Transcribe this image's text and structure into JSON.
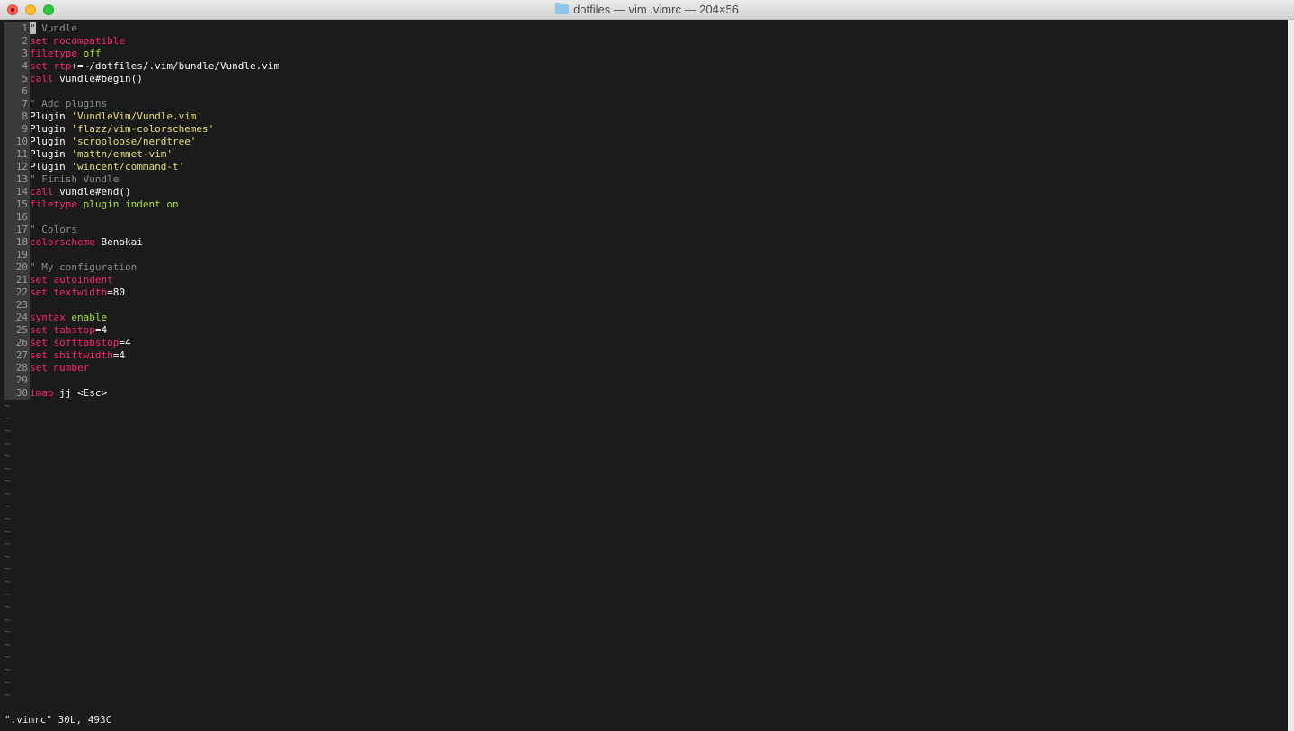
{
  "window": {
    "title": "dotfiles — vim .vimrc — 204×56"
  },
  "editor": {
    "lines": [
      {
        "n": "1",
        "tokens": [
          {
            "t": "\"",
            "c": "cursor"
          },
          {
            "t": " Vundle",
            "c": "com"
          }
        ]
      },
      {
        "n": "2",
        "tokens": [
          {
            "t": "set nocompatible",
            "c": "kw"
          }
        ]
      },
      {
        "n": "3",
        "tokens": [
          {
            "t": "filetype",
            "c": "kw"
          },
          {
            "t": " ",
            "c": "txt"
          },
          {
            "t": "off",
            "c": "grn"
          }
        ]
      },
      {
        "n": "4",
        "tokens": [
          {
            "t": "set",
            "c": "kw"
          },
          {
            "t": " ",
            "c": "txt"
          },
          {
            "t": "rtp",
            "c": "kw"
          },
          {
            "t": "+=~/dotfiles/.vim/bundle/Vundle.vim",
            "c": "txt"
          }
        ]
      },
      {
        "n": "5",
        "tokens": [
          {
            "t": "call",
            "c": "kw"
          },
          {
            "t": " vundle#begin()",
            "c": "txt"
          }
        ]
      },
      {
        "n": "6",
        "tokens": []
      },
      {
        "n": "7",
        "tokens": [
          {
            "t": "\" Add plugins",
            "c": "com"
          }
        ]
      },
      {
        "n": "8",
        "tokens": [
          {
            "t": "Plugin ",
            "c": "txt"
          },
          {
            "t": "'VundleVim/Vundle.vim'",
            "c": "str"
          }
        ]
      },
      {
        "n": "9",
        "tokens": [
          {
            "t": "Plugin ",
            "c": "txt"
          },
          {
            "t": "'flazz/vim-colorschemes'",
            "c": "str"
          }
        ]
      },
      {
        "n": "10",
        "tokens": [
          {
            "t": "Plugin ",
            "c": "txt"
          },
          {
            "t": "'scrooloose/nerdtree'",
            "c": "str"
          }
        ]
      },
      {
        "n": "11",
        "tokens": [
          {
            "t": "Plugin ",
            "c": "txt"
          },
          {
            "t": "'mattn/emmet-vim'",
            "c": "str"
          }
        ]
      },
      {
        "n": "12",
        "tokens": [
          {
            "t": "Plugin ",
            "c": "txt"
          },
          {
            "t": "'wincent/command-t'",
            "c": "str"
          }
        ]
      },
      {
        "n": "13",
        "tokens": [
          {
            "t": "\" Finish Vundle",
            "c": "com"
          }
        ]
      },
      {
        "n": "14",
        "tokens": [
          {
            "t": "call",
            "c": "kw"
          },
          {
            "t": " vundle#end()",
            "c": "txt"
          }
        ]
      },
      {
        "n": "15",
        "tokens": [
          {
            "t": "filetype",
            "c": "kw"
          },
          {
            "t": " ",
            "c": "txt"
          },
          {
            "t": "plugin indent on",
            "c": "grn"
          }
        ]
      },
      {
        "n": "16",
        "tokens": []
      },
      {
        "n": "17",
        "tokens": [
          {
            "t": "\" Colors",
            "c": "com"
          }
        ]
      },
      {
        "n": "18",
        "tokens": [
          {
            "t": "colorscheme",
            "c": "kw"
          },
          {
            "t": " Benokai",
            "c": "txt"
          }
        ]
      },
      {
        "n": "19",
        "tokens": []
      },
      {
        "n": "20",
        "tokens": [
          {
            "t": "\" My configuration",
            "c": "com"
          }
        ]
      },
      {
        "n": "21",
        "tokens": [
          {
            "t": "set autoindent",
            "c": "kw"
          }
        ]
      },
      {
        "n": "22",
        "tokens": [
          {
            "t": "set textwidth",
            "c": "kw"
          },
          {
            "t": "=80",
            "c": "txt"
          }
        ]
      },
      {
        "n": "23",
        "tokens": []
      },
      {
        "n": "24",
        "tokens": [
          {
            "t": "syntax",
            "c": "kw"
          },
          {
            "t": " ",
            "c": "txt"
          },
          {
            "t": "enable",
            "c": "grn"
          }
        ]
      },
      {
        "n": "25",
        "tokens": [
          {
            "t": "set tabstop",
            "c": "kw"
          },
          {
            "t": "=4",
            "c": "txt"
          }
        ]
      },
      {
        "n": "26",
        "tokens": [
          {
            "t": "set softtabstop",
            "c": "kw"
          },
          {
            "t": "=4",
            "c": "txt"
          }
        ]
      },
      {
        "n": "27",
        "tokens": [
          {
            "t": "set shiftwidth",
            "c": "kw"
          },
          {
            "t": "=4",
            "c": "txt"
          }
        ]
      },
      {
        "n": "28",
        "tokens": [
          {
            "t": "set number",
            "c": "kw"
          }
        ]
      },
      {
        "n": "29",
        "tokens": []
      },
      {
        "n": "30",
        "tokens": [
          {
            "t": "imap",
            "c": "kw"
          },
          {
            "t": " jj <Esc>",
            "c": "txt"
          }
        ]
      }
    ],
    "empty_marker": "~",
    "empty_line_count": 24
  },
  "status": {
    "text": "\".vimrc\" 30L, 493C"
  },
  "colors": {
    "keyword": "#f92672",
    "string": "#e6db74",
    "green": "#a6e22e",
    "comment": "#8a8a8a",
    "text": "#f8f8f2",
    "background": "#1b1b1b"
  }
}
